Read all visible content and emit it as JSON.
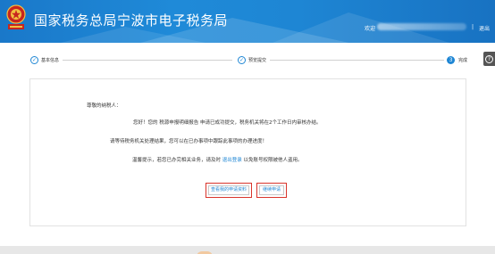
{
  "header": {
    "site_title": "国家税务总局宁波市电子税务局",
    "welcome_prefix": "欢迎",
    "separator": "|",
    "logout_label": "退出"
  },
  "steps": [
    {
      "number": "1",
      "label": "基本信息",
      "state": "done"
    },
    {
      "number": "2",
      "label": "预览提交",
      "state": "done"
    },
    {
      "number": "3",
      "label": "完成",
      "state": "active"
    }
  ],
  "help": {
    "icon": "question-icon",
    "glyph": "?"
  },
  "message": {
    "greeting": "尊敬的纳税人：",
    "line1": "您好！您的 税源申报明细报告 申请已成功提交，税务机关将在2个工作日内审核办结。",
    "line2": "请等待税务机关处理结果，您可以在已办事项中跟踪此事项的办理进度！",
    "line3_prefix": "温馨提示，若您已办完相关业务，请及时",
    "line3_link": "退出登录",
    "line3_suffix": "以免账号权限被他人盗用。"
  },
  "buttons": {
    "view_details": "查看我的申请资料",
    "continue": "继续申请"
  },
  "colors": {
    "header_blue": "#1e86d4",
    "accent_red": "#d9342b",
    "link_blue": "#1e86d4"
  }
}
